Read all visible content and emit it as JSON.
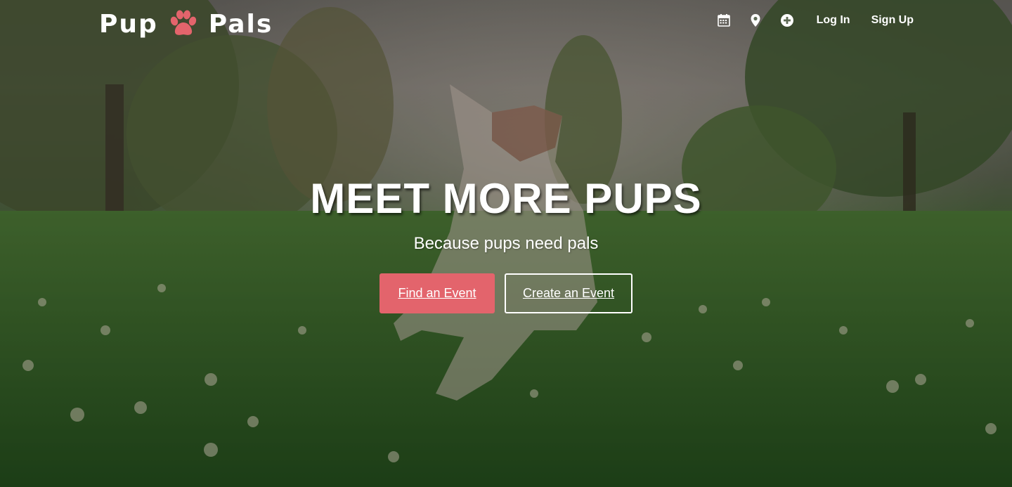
{
  "brand": {
    "name_left": "Pup",
    "name_right": "Pals",
    "logo_icon": "paw-icon",
    "accent_color": "#e3646c"
  },
  "nav": {
    "icons": [
      "calendar-icon",
      "map-pin-icon",
      "plus-circle-icon"
    ],
    "login_label": "Log In",
    "signup_label": "Sign Up"
  },
  "hero": {
    "headline": "MEET MORE PUPS",
    "subtitle": "Because pups need pals",
    "primary_button": "Find an Event",
    "secondary_button": "Create an Event",
    "background": "photo of a dog running through a grassy park with clover flowers and trees"
  }
}
